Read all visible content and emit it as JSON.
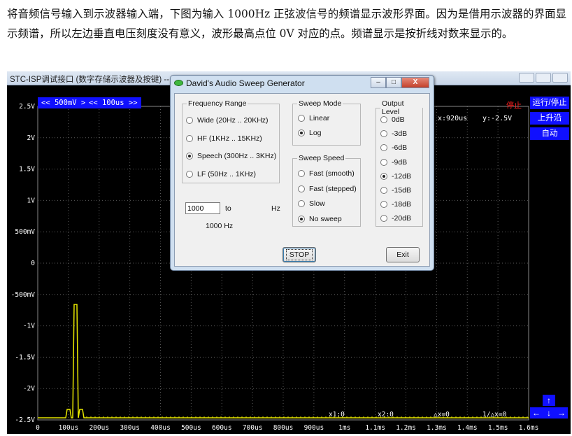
{
  "document": {
    "paragraph": "将音频信号输入到示波器输入端，下图为输入 1000Hz 正弦波信号的频谱显示波形界面。因为是借用示波器的界面显示频谱，所以左边垂直电压刻度没有意义，波形最高点位 0V 对应的点。频谱显示是按折线对数来显示的。"
  },
  "window": {
    "title": "STC-ISP调试接口 (数字存储示波器及按键) -- ww"
  },
  "toolbar": {
    "volt_div": "<< 500mV >>",
    "time_div": "<< 100us >>",
    "stop_status": "停止",
    "run_stop": "运行/停止",
    "rising_edge": "上升沿",
    "auto": "自动",
    "x_readout": "x:920us",
    "y_readout": "y:-2.5V"
  },
  "scope": {
    "y_labels": [
      "2.5V",
      "2V",
      "1.5V",
      "1V",
      "500mV",
      "0",
      "-500mV",
      "-1V",
      "-1.5V",
      "-2V",
      "-2.5V"
    ],
    "x_labels": [
      "0",
      "100us",
      "200us",
      "300us",
      "400us",
      "500us",
      "600us",
      "700us",
      "800us",
      "900us",
      "1ms",
      "1.1ms",
      "1.2ms",
      "1.3ms",
      "1.4ms",
      "1.5ms",
      "1.6ms"
    ],
    "cursors": [
      "x1:0",
      "x2:0",
      "△x=0",
      "1/△x=0"
    ],
    "trace_color": "#e8e800",
    "grid_color": "#5a5a5a"
  },
  "nav": {
    "up": "↑",
    "left": "←",
    "down": "↓",
    "right": "→"
  },
  "dialog": {
    "title": "David's Audio Sweep Generator",
    "minimize": "–",
    "maximize": "□",
    "close": "X",
    "frequency_range": {
      "legend": "Frequency Range",
      "options": [
        "Wide (20Hz .. 20KHz)",
        "HF (1KHz .. 15KHz)",
        "Speech (300Hz .. 3KHz)",
        "LF (50Hz .. 1KHz)"
      ],
      "selected": 2
    },
    "frequency_value": "1000",
    "to_label": "to",
    "hz_label": "Hz",
    "frequency_display": "1000 Hz",
    "sweep_mode": {
      "legend": "Sweep Mode",
      "options": [
        "Linear",
        "Log"
      ],
      "selected": 1
    },
    "sweep_speed": {
      "legend": "Sweep Speed",
      "options": [
        "Fast (smooth)",
        "Fast (stepped)",
        "Slow",
        "No sweep"
      ],
      "selected": 3
    },
    "output_level": {
      "legend": "Output Level",
      "options": [
        "0dB",
        "-3dB",
        "-6dB",
        "-9dB",
        "-12dB",
        "-15dB",
        "-18dB",
        "-20dB"
      ],
      "selected": 4
    },
    "stop_button": "STOP",
    "exit_button": "Exit"
  }
}
